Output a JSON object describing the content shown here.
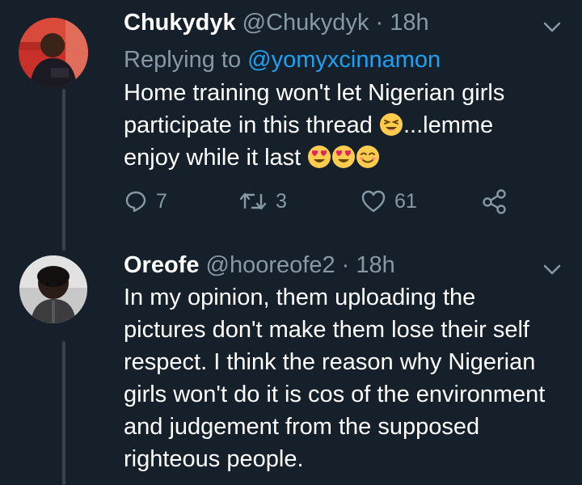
{
  "tweets": [
    {
      "display_name": "Chukydyk",
      "handle": "@Chukydyk",
      "separator": "·",
      "time": "18h",
      "replying_prefix": "Replying to",
      "replying_to": "@yomyxcinnamon",
      "lines": [
        "Home training won't let Nigerian girls",
        "participate in this thread",
        "...lemme",
        "enjoy while it last"
      ],
      "emojis": [
        "laughing-squint-emoji",
        "heart-eyes-emoji",
        "heart-eyes-emoji",
        "smiling-blush-emoji"
      ],
      "actions": {
        "reply_count": "7",
        "retweet_count": "3",
        "like_count": "61"
      }
    },
    {
      "display_name": "Oreofe",
      "handle": "@hooreofe2",
      "separator": "·",
      "time": "18h",
      "lines": [
        "In my opinion, them uploading the",
        "pictures don't make them lose their self",
        "respect. I think the reason why Nigerian",
        "girls won't do it is cos of the environment",
        "and judgement from the supposed",
        "righteous people."
      ]
    }
  ],
  "colors": {
    "background": "#15202b",
    "text": "#ffffff",
    "muted": "#8899a6",
    "link": "#1da1f2",
    "thread_line": "#38444d"
  }
}
